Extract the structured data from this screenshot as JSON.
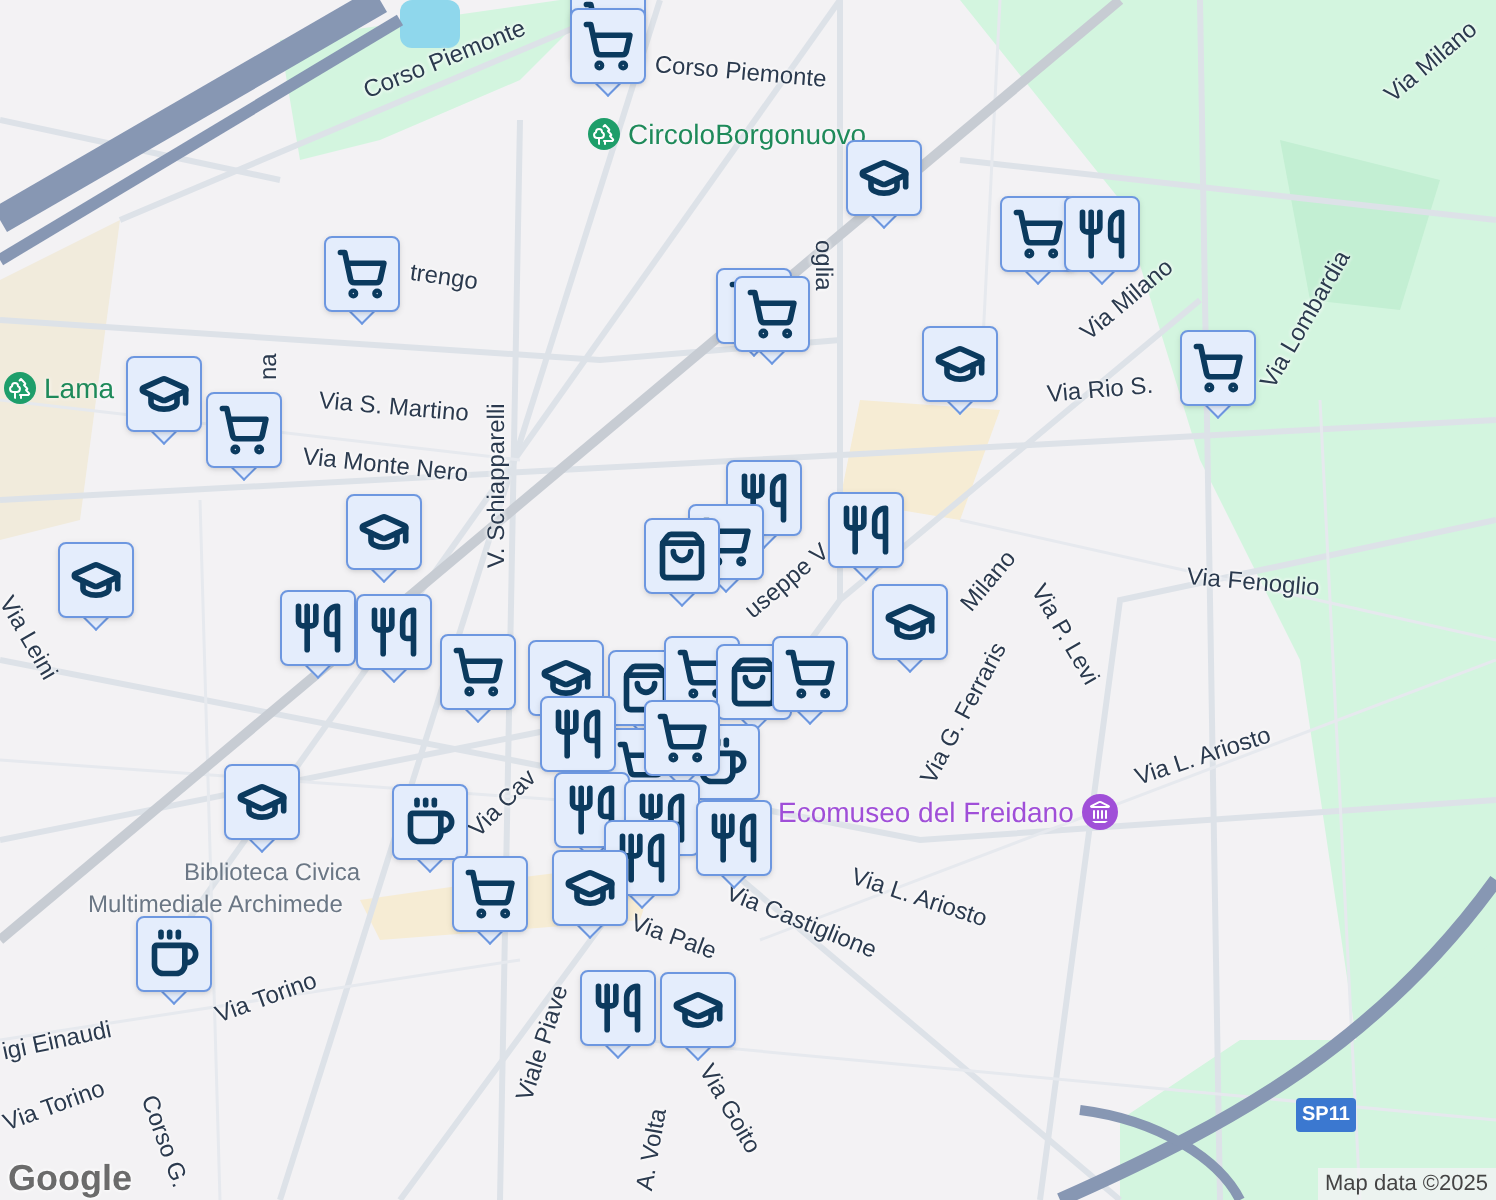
{
  "map": {
    "labels": [
      {
        "text": "Corso Piemonte",
        "kind": "street"
      },
      {
        "text": "Corso Piemonte",
        "kind": "street"
      },
      {
        "text": "CircoloBorgonuovo",
        "kind": "park"
      },
      {
        "text": "Via Milano",
        "kind": "street"
      },
      {
        "text": "oglia",
        "kind": "street"
      },
      {
        "text": "trengo",
        "kind": "street"
      },
      {
        "text": "Via Milano",
        "kind": "street"
      },
      {
        "text": "Via Lombardia",
        "kind": "street"
      },
      {
        "text": "Lama",
        "kind": "park"
      },
      {
        "text": "na",
        "kind": "street"
      },
      {
        "text": "Via S. Martino",
        "kind": "street"
      },
      {
        "text": "Via Monte Nero",
        "kind": "street"
      },
      {
        "text": "Via Rio S.",
        "kind": "street"
      },
      {
        "text": "V. Schiapparelli",
        "kind": "street"
      },
      {
        "text": "Milano",
        "kind": "street"
      },
      {
        "text": "useppe V",
        "kind": "street"
      },
      {
        "text": "Via Fenoglio",
        "kind": "street"
      },
      {
        "text": "Via P. Levi",
        "kind": "street"
      },
      {
        "text": "Via Leini",
        "kind": "street"
      },
      {
        "text": "Via G. Ferraris",
        "kind": "street"
      },
      {
        "text": "Ecomuseo del Freidano",
        "kind": "museum"
      },
      {
        "text": "Via L. Ariosto",
        "kind": "street"
      },
      {
        "text": "Via Cav",
        "kind": "street"
      },
      {
        "text": "Via L. Ariosto",
        "kind": "street"
      },
      {
        "text": "Biblioteca Civica",
        "kind": "place"
      },
      {
        "text": "Multimediale Archimede",
        "kind": "place"
      },
      {
        "text": "Via Castiglione",
        "kind": "street"
      },
      {
        "text": "Via Pale",
        "kind": "street"
      },
      {
        "text": "Viale Piave",
        "kind": "street"
      },
      {
        "text": "Via Torino",
        "kind": "street"
      },
      {
        "text": "igi Einaudi",
        "kind": "street"
      },
      {
        "text": "Via Torino",
        "kind": "street"
      },
      {
        "text": "Corso G.",
        "kind": "street"
      },
      {
        "text": "Via Goito",
        "kind": "street"
      },
      {
        "text": "A. Volta",
        "kind": "street"
      }
    ],
    "markers": [
      {
        "kind": "cart"
      },
      {
        "kind": "cart"
      },
      {
        "kind": "school"
      },
      {
        "kind": "cart"
      },
      {
        "kind": "cart"
      },
      {
        "kind": "restaurant"
      },
      {
        "kind": "cart"
      },
      {
        "kind": "cart"
      },
      {
        "kind": "school"
      },
      {
        "kind": "cart"
      },
      {
        "kind": "school"
      },
      {
        "kind": "cart"
      },
      {
        "kind": "restaurant"
      },
      {
        "kind": "cart"
      },
      {
        "kind": "bag"
      },
      {
        "kind": "restaurant"
      },
      {
        "kind": "school"
      },
      {
        "kind": "school"
      },
      {
        "kind": "restaurant"
      },
      {
        "kind": "restaurant"
      },
      {
        "kind": "school"
      },
      {
        "kind": "cart"
      },
      {
        "kind": "school"
      },
      {
        "kind": "bag"
      },
      {
        "kind": "cart"
      },
      {
        "kind": "bag"
      },
      {
        "kind": "cart"
      },
      {
        "kind": "cafe"
      },
      {
        "kind": "cart"
      },
      {
        "kind": "restaurant"
      },
      {
        "kind": "cart"
      },
      {
        "kind": "restaurant"
      },
      {
        "kind": "restaurant"
      },
      {
        "kind": "restaurant"
      },
      {
        "kind": "restaurant"
      },
      {
        "kind": "school"
      },
      {
        "kind": "cafe"
      },
      {
        "kind": "cart"
      },
      {
        "kind": "school"
      },
      {
        "kind": "cafe"
      },
      {
        "kind": "restaurant"
      },
      {
        "kind": "school"
      }
    ],
    "road_shield": "SP11"
  },
  "attribution": "Map data ©2025",
  "logo": "Google"
}
